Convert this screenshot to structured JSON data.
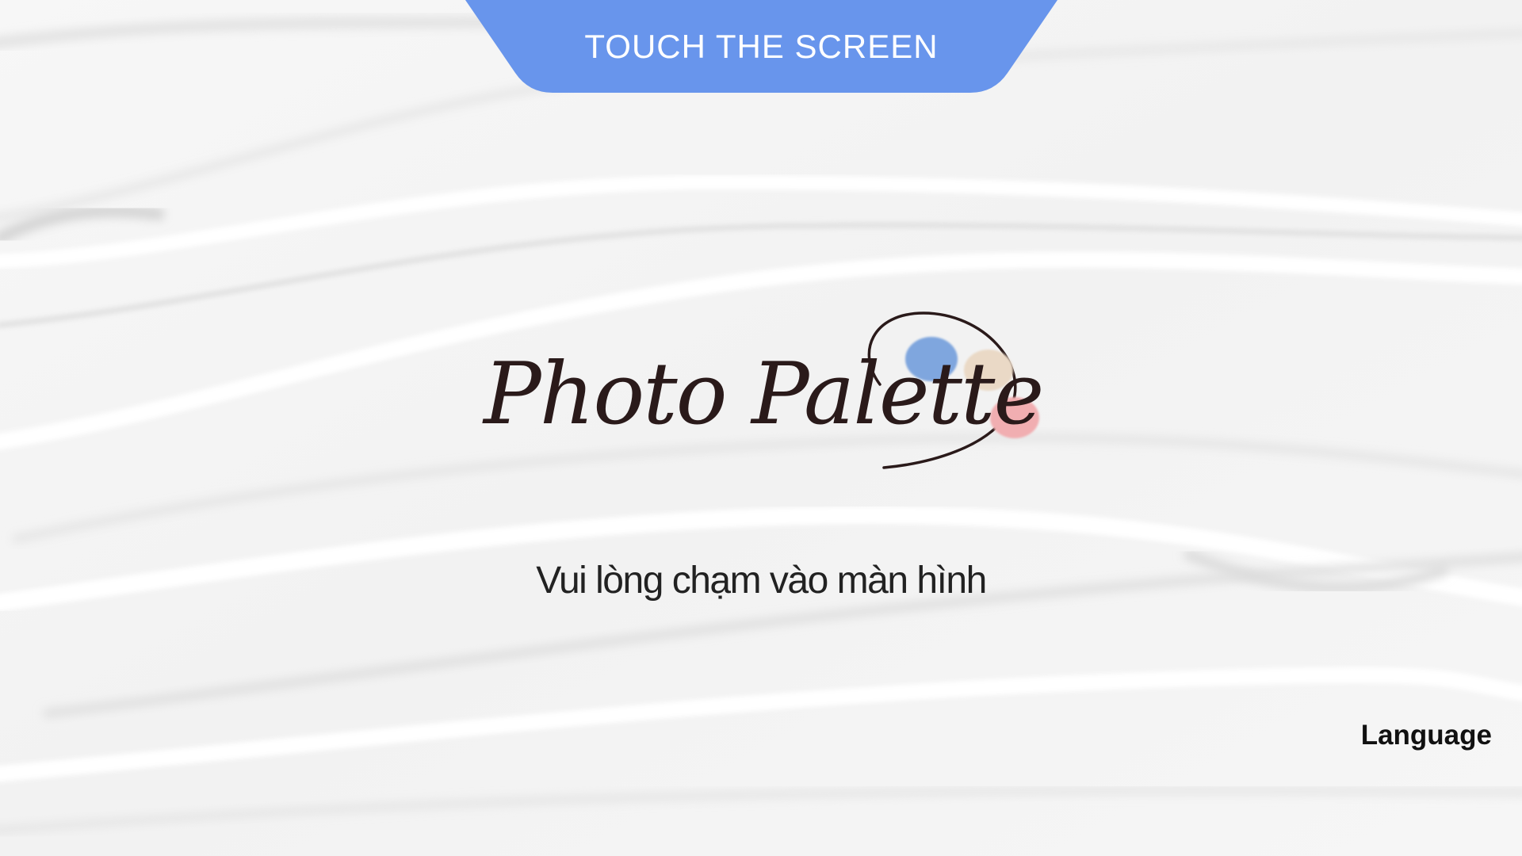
{
  "banner": {
    "label": "TOUCH THE SCREEN",
    "color": "#6895ec"
  },
  "logo": {
    "text": "Photo Palette",
    "paint_colors": [
      "#7fa6de",
      "#ead9c6",
      "#f1aeb1"
    ]
  },
  "prompt": {
    "text": "Vui lòng chạm vào màn hình"
  },
  "language_button": {
    "label": "Language"
  }
}
